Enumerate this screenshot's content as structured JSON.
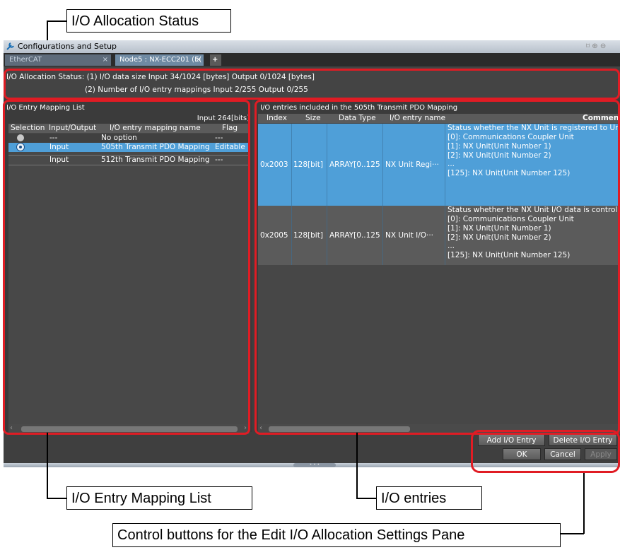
{
  "callouts": {
    "status": "I/O Allocation Status",
    "mapping_list": "I/O Entry Mapping List",
    "entries": "I/O entries",
    "buttons": "Control buttons for the Edit I/O Allocation Settings Pane"
  },
  "window": {
    "title": "Configurations and Setup",
    "tabs": [
      "EtherCAT",
      "Node5 : NX-ECC201 (E("
    ],
    "add_tab": "+"
  },
  "status": {
    "line1": "I/O Allocation Status: (1) I/O data size Input 34/1024 [bytes] Output 0/1024 [bytes]",
    "line2": "(2) Number of I/O entry mappings Input 2/255 Output 0/255"
  },
  "mapping_list": {
    "title": "I/O Entry Mapping List",
    "input_bits": "Input 264[bits]",
    "columns": [
      "Selection",
      "Input/Output",
      "I/O entry mapping name",
      "Flag"
    ],
    "rows": [
      {
        "io": "---",
        "name": "No option",
        "flag": "---"
      },
      {
        "io": "Input",
        "name": "505th Transmit PDO Mapping",
        "flag": "Editable"
      },
      {
        "io": "Input",
        "name": "512th Transmit PDO Mapping",
        "flag": "---"
      }
    ]
  },
  "entries": {
    "title": "I/O entries included in the 505th Transmit PDO Mapping",
    "columns": [
      "Index",
      "Size",
      "Data Type",
      "I/O entry name",
      "Comment"
    ],
    "rows": [
      {
        "index": "0x2003",
        "size": "128[bit]",
        "type": "ARRAY[0..125",
        "name": "NX Unit Regi···",
        "comment": [
          "Status whether the NX Unit is registered to Unit c",
          "[0]: Communications Coupler Unit",
          "[1]: NX Unit(Unit Number 1)",
          "[2]: NX Unit(Unit Number 2)",
          "...",
          "[125]: NX Unit(Unit Number 125)"
        ]
      },
      {
        "index": "0x2005",
        "size": "128[bit]",
        "type": "ARRAY[0..125",
        "name": "NX Unit I/O···",
        "comment": [
          "Status whether the NX Unit I/O data is controlled",
          "[0]: Communications Coupler Unit",
          "[1]: NX Unit(Unit Number 1)",
          "[2]: NX Unit(Unit Number 2)",
          "...",
          "[125]: NX Unit(Unit Number 125)"
        ]
      }
    ]
  },
  "buttons": {
    "add": "Add I/O Entry",
    "delete": "Delete I/O Entry",
    "ok": "OK",
    "cancel": "Cancel",
    "apply": "Apply"
  },
  "colors": {
    "highlight": "#4f9fd8",
    "callout_red": "#e01c24"
  }
}
